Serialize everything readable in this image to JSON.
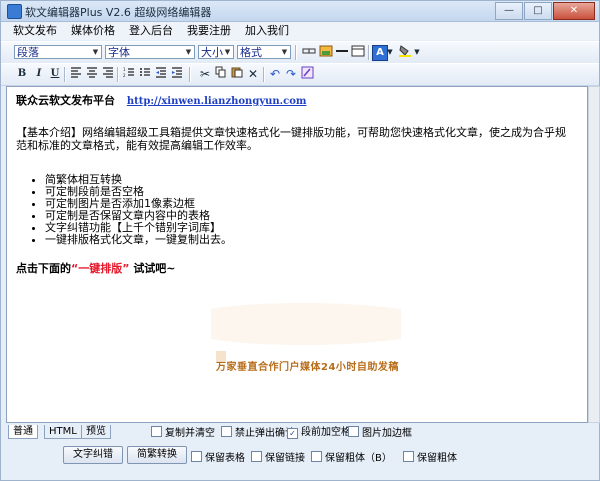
{
  "window": {
    "title": "软文编辑器Plus V2.6 超级网络编辑器",
    "minimize": "—",
    "maximize": "□",
    "close": "✕"
  },
  "menu": [
    "软文发布",
    "媒体价格",
    "登入后台",
    "我要注册",
    "加入我们"
  ],
  "toolbar1": {
    "paragraph_select": "段落",
    "font_select": "字体",
    "size_select": "大小",
    "format_select": "格式"
  },
  "toolbar2": {
    "bold": "B",
    "italic": "I",
    "underline": "U"
  },
  "editor": {
    "heading": "联众云软文发布平台",
    "heading_link": "http://xinwen.lianzhongyun.com",
    "intro": "【基本介绍】网络编辑超级工具箱提供文章快速格式化一键排版功能，可帮助您快速格式化文章，使之成为合乎规范和标准的文章格式，能有效提高编辑工作效率。",
    "features": [
      "简繁体相互转换",
      "可定制段前是否空格",
      "可定制图片是否添加1像素边框",
      "可定制是否保留文章内容中的表格",
      "文字纠错功能【上千个错别字词库】",
      "一键排版格式化文章，一键复制出去。"
    ],
    "cta_pre": "点击下面的",
    "cta_highlight": "“一键排版”",
    "cta_post": "试试吧~",
    "watermark_text": "万家垂直合作门户媒体24小时自助发稿"
  },
  "tabs": [
    "普通",
    "HTML",
    "预览"
  ],
  "options_row1": [
    {
      "label": "复制并清空",
      "checked": false
    },
    {
      "label": "禁止弹出确认",
      "checked": false
    },
    {
      "label": "段前加空格",
      "checked": true
    },
    {
      "label": "图片加边框",
      "checked": false
    }
  ],
  "buttons": {
    "text_correct": "文字纠错",
    "trad_simp": "简繁转换"
  },
  "options_row2": [
    {
      "label": "保留表格",
      "checked": false
    },
    {
      "label": "保留链接",
      "checked": false
    },
    {
      "label": "保留粗体（B）",
      "checked": false
    },
    {
      "label": "保留粗体",
      "checked": false
    }
  ]
}
